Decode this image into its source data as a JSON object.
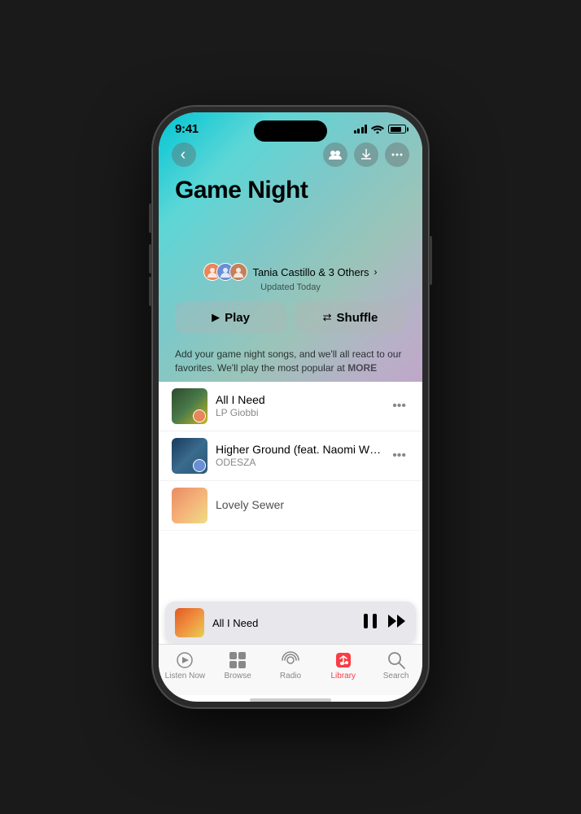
{
  "status": {
    "time": "9:41",
    "battery_level": 80
  },
  "header": {
    "title": "Game Night",
    "back_label": "back"
  },
  "playlist": {
    "title": "Game Night",
    "collaborators": "Tania Castillo & 3 Others",
    "updated": "Updated Today",
    "description": "Add your game night songs, and we'll all react to our favorites. We'll play the most popular at",
    "more_label": "MORE"
  },
  "actions": {
    "play_label": "Play",
    "shuffle_label": "Shuffle"
  },
  "songs": [
    {
      "title": "All I Need",
      "artist": "LP Giobbi",
      "art_class": "song-art-1"
    },
    {
      "title": "Higher Ground (feat. Naomi Wild)",
      "artist": "ODESZA",
      "art_class": "song-art-2"
    },
    {
      "title": "Lovely Sewer",
      "artist": "",
      "art_class": "song-art-3"
    }
  ],
  "mini_player": {
    "title": "All I Need",
    "art_class": "mini-art"
  },
  "tabs": [
    {
      "id": "listen-now",
      "label": "Listen Now",
      "icon": "▶",
      "active": false
    },
    {
      "id": "browse",
      "label": "Browse",
      "icon": "⊞",
      "active": false
    },
    {
      "id": "radio",
      "label": "Radio",
      "icon": "◉",
      "active": false
    },
    {
      "id": "library",
      "label": "Library",
      "icon": "♪",
      "active": true
    },
    {
      "id": "search",
      "label": "Search",
      "icon": "⌕",
      "active": false
    }
  ]
}
